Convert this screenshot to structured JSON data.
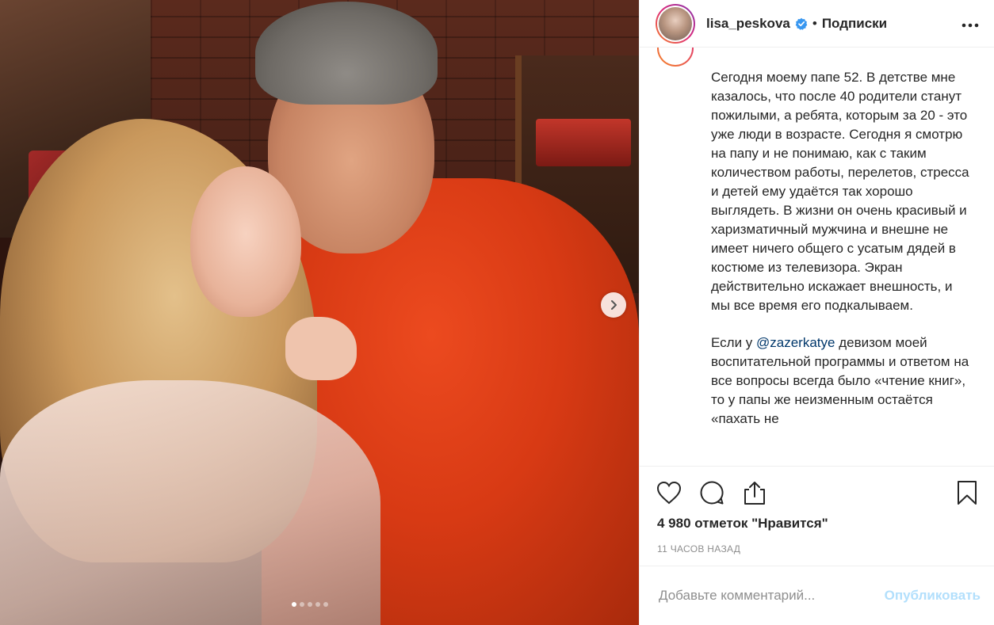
{
  "header": {
    "username": "lisa_peskova",
    "separator": "•",
    "follow_status": "Подписки",
    "more": "•••"
  },
  "caption": {
    "paragraph_1": "Сегодня моему папе 52. В детстве мне казалось, что после 40 родители станут пожилыми, а ребята, которым за 20 - это уже люди в возрасте. Сегодня я смотрю на папу и не понимаю, как с таким количеством работы, перелетов, стресса и детей ему удаётся так хорошо выглядеть. В жизни он очень красивый и харизматичный мужчина и внешне не имеет ничего общего с усатым дядей в костюме из телевизора. Экран действительно искажает внешность, и мы все время его подкалываем.",
    "p2_prefix": "Если у ",
    "mention": "@zazerkatye",
    "p2_suffix": " девизом моей воспитательной программы и ответом на все вопросы всегда было «чтение книг», то у папы же неизменным остаётся «пахать не"
  },
  "stats": {
    "likes": "4 980 отметок \"Нравится\"",
    "time_ago": "11 ЧАСОВ НАЗАД"
  },
  "comment": {
    "placeholder": "Добавьте комментарий...",
    "publish_label": "Опубликовать"
  },
  "carousel": {
    "total_slides": 5,
    "active_slide": 1
  },
  "icons": {
    "verified": "verified-badge-icon",
    "next": "chevron-right-icon",
    "like": "heart-icon",
    "comment": "comment-bubble-icon",
    "share": "share-upload-icon",
    "save": "bookmark-icon",
    "more": "more-horizontal-icon"
  },
  "colors": {
    "verified_blue": "#3897f0",
    "mention": "#00376b",
    "publish_disabled": "#b2dffc",
    "muted_text": "#8e8e8e"
  }
}
